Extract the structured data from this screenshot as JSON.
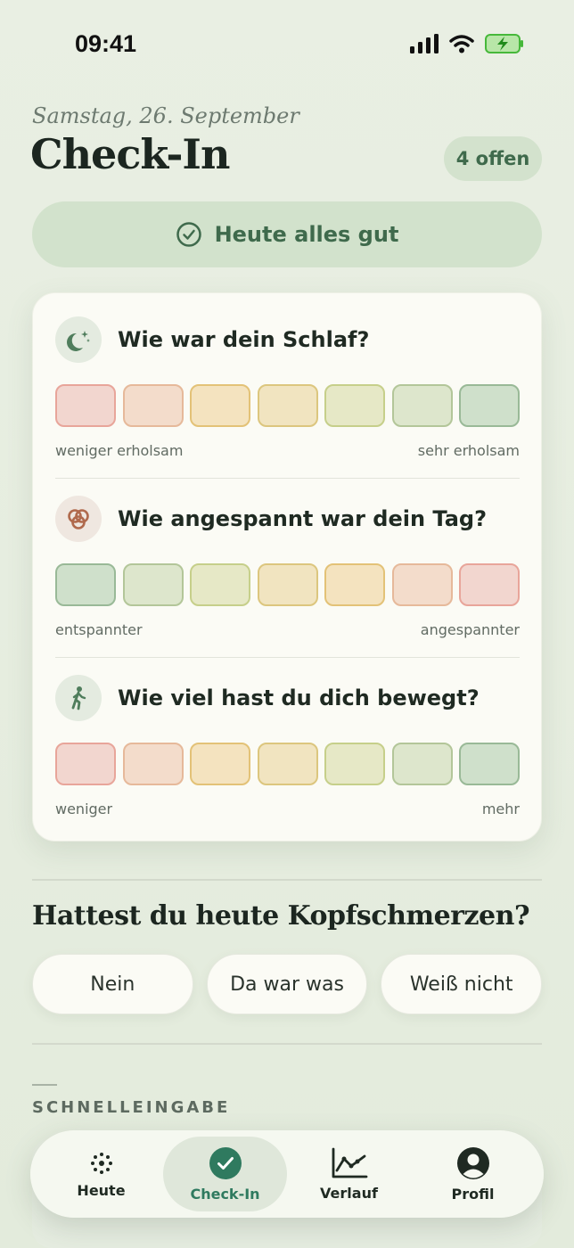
{
  "status": {
    "time": "09:41"
  },
  "header": {
    "date": "Samstag, 26. September",
    "title": "Check-In",
    "open_badge": "4 offen"
  },
  "all_good_button": {
    "label": "Heute alles gut"
  },
  "questions": [
    {
      "icon": "moon-stars-icon",
      "title": "Wie war dein Schlaf?",
      "low_label": "weniger erholsam",
      "high_label": "sehr erholsam",
      "scale": "red-to-green",
      "selected": null
    },
    {
      "icon": "knot-icon",
      "title": "Wie angespannt war dein Tag?",
      "low_label": "entspannter",
      "high_label": "angespannter",
      "scale": "green-to-red",
      "selected": null
    },
    {
      "icon": "walking-icon",
      "title": "Wie viel hast du dich bewegt?",
      "low_label": "weniger",
      "high_label": "mehr",
      "scale": "red-to-green",
      "selected": null
    }
  ],
  "headache": {
    "question": "Hattest du heute Kopfschmerzen?",
    "options": [
      "Nein",
      "Da war was",
      "Weiß nicht"
    ]
  },
  "quick_entry": {
    "label": "SCHNELLEINGABE"
  },
  "tabs": [
    {
      "label": "Heute",
      "icon": "dots-circle-icon",
      "active": false
    },
    {
      "label": "Check-In",
      "icon": "check-circle-icon",
      "active": true
    },
    {
      "label": "Verlauf",
      "icon": "chart-line-icon",
      "active": false
    },
    {
      "label": "Profil",
      "icon": "profile-icon",
      "active": false
    }
  ],
  "colors": {
    "accent": "#2f7a5f",
    "scale_red_to_green": [
      [
        "#f2d6cf",
        "#e8a59a"
      ],
      [
        "#f3dccb",
        "#e6b99a"
      ],
      [
        "#f4e3bf",
        "#e3c277"
      ],
      [
        "#f1e4c0",
        "#dcc67e"
      ],
      [
        "#e6e8c6",
        "#c6cf8a"
      ],
      [
        "#dde6cc",
        "#b3c699"
      ],
      [
        "#cfe0cb",
        "#99b997"
      ]
    ]
  }
}
